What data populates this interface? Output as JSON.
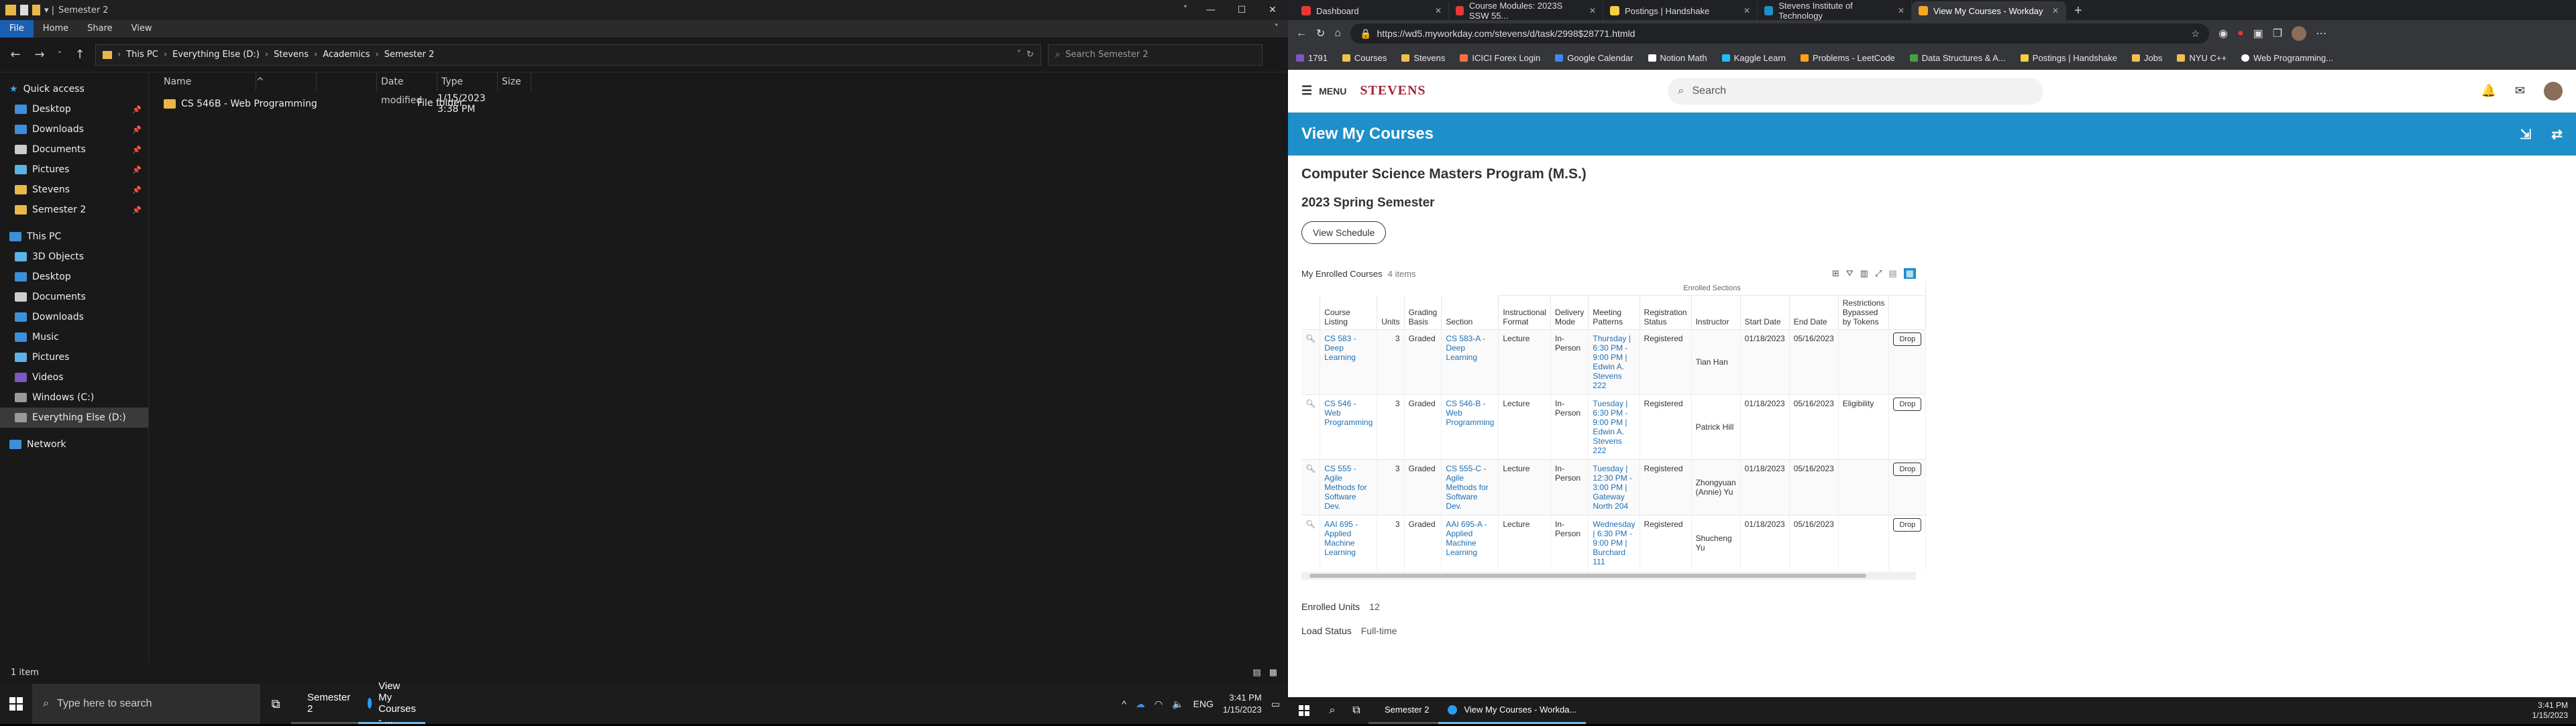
{
  "explorer": {
    "title": "Semester 2",
    "ribbon": [
      "File",
      "Home",
      "Share",
      "View"
    ],
    "breadcrumb": [
      "This PC",
      "Everything Else (D:)",
      "Stevens",
      "Academics",
      "Semester 2"
    ],
    "search_placeholder": "Search Semester 2",
    "nav": [
      {
        "label": "Quick access",
        "icon": "star-icon",
        "pinned": false
      },
      {
        "label": "Desktop",
        "icon": "desktop-icon",
        "pinned": true
      },
      {
        "label": "Downloads",
        "icon": "download-icon",
        "pinned": true
      },
      {
        "label": "Documents",
        "icon": "documents-icon",
        "pinned": true
      },
      {
        "label": "Pictures",
        "icon": "pictures-icon",
        "pinned": true
      },
      {
        "label": "Stevens",
        "icon": "folder-icon",
        "pinned": true
      },
      {
        "label": "Semester 2",
        "icon": "folder-icon",
        "pinned": true
      },
      {
        "label": "This PC",
        "icon": "pc-icon",
        "pinned": false
      },
      {
        "label": "3D Objects",
        "icon": "cube-icon",
        "pinned": false
      },
      {
        "label": "Desktop",
        "icon": "desktop-icon",
        "pinned": false
      },
      {
        "label": "Documents",
        "icon": "documents-icon",
        "pinned": false
      },
      {
        "label": "Downloads",
        "icon": "download-icon",
        "pinned": false
      },
      {
        "label": "Music",
        "icon": "music-icon",
        "pinned": false
      },
      {
        "label": "Pictures",
        "icon": "pictures-icon",
        "pinned": false
      },
      {
        "label": "Videos",
        "icon": "video-icon",
        "pinned": false
      },
      {
        "label": "Windows (C:)",
        "icon": "drive-icon",
        "pinned": false
      },
      {
        "label": "Everything Else (D:)",
        "icon": "drive-icon",
        "pinned": false
      },
      {
        "label": "Network",
        "icon": "network-icon",
        "pinned": false
      }
    ],
    "columns": [
      "Name",
      "Date modified",
      "Type",
      "Size"
    ],
    "files": [
      {
        "name": "CS 546B - Web Programming",
        "modified": "1/15/2023 3:38 PM",
        "type": "File folder",
        "size": ""
      }
    ],
    "status": "1 item"
  },
  "taskbar": {
    "search_placeholder": "Type here to search",
    "apps": [
      "Semester 2",
      "View My Courses - ..."
    ],
    "lang": "ENG",
    "time": "3:41 PM",
    "date": "1/15/2023"
  },
  "taskbar2": {
    "apps": [
      "Semester 2",
      "View My Courses - Workda..."
    ],
    "time": "3:41 PM",
    "date": "1/15/2023"
  },
  "browser": {
    "tabs": [
      {
        "title": "Dashboard",
        "color": "#e53935"
      },
      {
        "title": "Course Modules: 2023S SSW 55...",
        "color": "#e53935"
      },
      {
        "title": "Postings | Handshake",
        "color": "#f5d142"
      },
      {
        "title": "Stevens Institute of Technology",
        "color": "#1e8fc9"
      },
      {
        "title": "View My Courses - Workday",
        "color": "#f5a623"
      }
    ],
    "url": "https://wd5.myworkday.com/stevens/d/task/2998$28771.htmld",
    "bookmarks": [
      "1791",
      "Courses",
      "Stevens",
      "ICICI Forex Login",
      "Google Calendar",
      "Notion Math",
      "Kaggle Learn",
      "Problems - LeetCode",
      "Data Structures & A...",
      "Postings | Handshake",
      "Jobs",
      "NYU C++",
      "Web Programming..."
    ]
  },
  "workday": {
    "menu": "MENU",
    "logo": "STEVENS",
    "search_placeholder": "Search",
    "page_title": "View My Courses",
    "program": "Computer Science Masters Program (M.S.)",
    "semester": "2023 Spring Semester",
    "view_schedule": "View Schedule",
    "grid_title": "My Enrolled Courses",
    "item_count": "4 items",
    "group_header": "Enrolled Sections",
    "columns": [
      "Course Listing",
      "Units",
      "Grading Basis",
      "Section",
      "Instructional Format",
      "Delivery Mode",
      "Meeting Patterns",
      "Registration Status",
      "Instructor",
      "Start Date",
      "End Date",
      "Restrictions Bypassed by Tokens"
    ],
    "rows": [
      {
        "course": "CS 583 - Deep Learning",
        "units": "3",
        "grading": "Graded",
        "section": "CS 583-A - Deep Learning",
        "format": "Lecture",
        "delivery": "In-Person",
        "meeting": "Thursday | 6:30 PM - 9:00 PM | Edwin A. Stevens 222",
        "status": "Registered",
        "instructor": "Tian Han",
        "start": "01/18/2023",
        "end": "05/16/2023",
        "restrictions": "",
        "action": "Drop"
      },
      {
        "course": "CS 546 - Web Programming",
        "units": "3",
        "grading": "Graded",
        "section": "CS 546-B - Web Programming",
        "format": "Lecture",
        "delivery": "In-Person",
        "meeting": "Tuesday | 6:30 PM - 9:00 PM | Edwin A. Stevens 222",
        "status": "Registered",
        "instructor": "Patrick Hill",
        "start": "01/18/2023",
        "end": "05/16/2023",
        "restrictions": "Eligibility",
        "action": "Drop"
      },
      {
        "course": "CS 555 - Agile Methods for Software Dev.",
        "units": "3",
        "grading": "Graded",
        "section": "CS 555-C - Agile Methods for Software Dev.",
        "format": "Lecture",
        "delivery": "In-Person",
        "meeting": "Tuesday | 12:30 PM - 3:00 PM | Gateway North 204",
        "status": "Registered",
        "instructor": "Zhongyuan (Annie) Yu",
        "start": "01/18/2023",
        "end": "05/16/2023",
        "restrictions": "",
        "action": "Drop"
      },
      {
        "course": "AAI 695 - Applied Machine Learning",
        "units": "3",
        "grading": "Graded",
        "section": "AAI 695-A - Applied Machine Learning",
        "format": "Lecture",
        "delivery": "In-Person",
        "meeting": "Wednesday | 6:30 PM - 9:00 PM | Burchard 111",
        "status": "Registered",
        "instructor": "Shucheng Yu",
        "start": "01/18/2023",
        "end": "05/16/2023",
        "restrictions": "",
        "action": "Drop"
      }
    ],
    "enrolled_units_label": "Enrolled Units",
    "enrolled_units": "12",
    "load_status_label": "Load Status",
    "load_status": "Full-time"
  }
}
